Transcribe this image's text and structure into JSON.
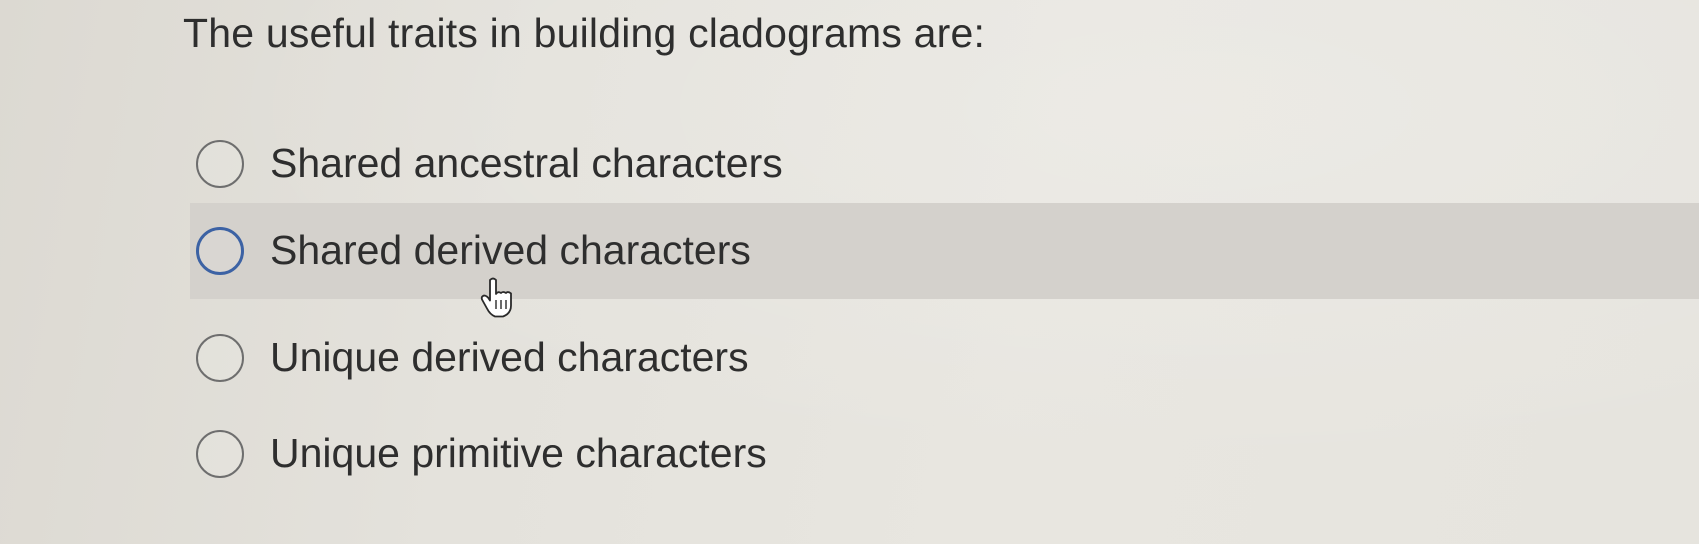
{
  "question": {
    "text": "The useful traits in building cladograms are:"
  },
  "options": [
    {
      "label": "Shared ancestral characters",
      "selected": false,
      "hovered": false
    },
    {
      "label": "Shared derived characters",
      "selected": false,
      "hovered": true
    },
    {
      "label": "Unique derived characters",
      "selected": false,
      "hovered": false
    },
    {
      "label": "Unique primitive characters",
      "selected": false,
      "hovered": false
    }
  ],
  "cursor": {
    "icon": "pointer-hand-icon"
  },
  "colors": {
    "background": "#e4e2dc",
    "hover_row": "#d4d1cc",
    "focus_radio_border": "#3c62a4",
    "radio_border": "#6e6e6e",
    "text": "#2e2e2e"
  }
}
